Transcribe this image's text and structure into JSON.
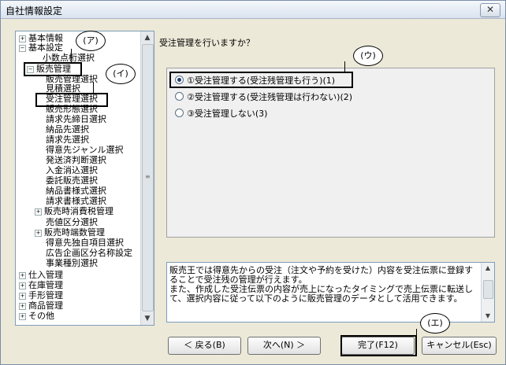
{
  "window": {
    "title": "自社情報設定",
    "close_glyph": "✕"
  },
  "tree": {
    "items": [
      {
        "label": "基本情報",
        "exp": "+"
      },
      {
        "label": "基本設定",
        "exp": "−"
      },
      {
        "label": "小数点桁選択",
        "exp": ""
      },
      {
        "label": "販売管理",
        "exp": "−"
      },
      {
        "label": "販売管理選択",
        "exp": ""
      },
      {
        "label": "見積選択",
        "exp": ""
      },
      {
        "label": "受注管理選択",
        "exp": ""
      },
      {
        "label": "販売形態選択",
        "exp": ""
      },
      {
        "label": "請求先締日選択",
        "exp": ""
      },
      {
        "label": "納品先選択",
        "exp": ""
      },
      {
        "label": "請求先選択",
        "exp": ""
      },
      {
        "label": "得意先ジャンル選択",
        "exp": ""
      },
      {
        "label": "発送済判断選択",
        "exp": ""
      },
      {
        "label": "入金消込選択",
        "exp": ""
      },
      {
        "label": "委託販売選択",
        "exp": ""
      },
      {
        "label": "納品書様式選択",
        "exp": ""
      },
      {
        "label": "請求書様式選択",
        "exp": ""
      },
      {
        "label": "販売時消費税管理",
        "exp": "+"
      },
      {
        "label": "売値区分選択",
        "exp": ""
      },
      {
        "label": "販売時端数管理",
        "exp": "+"
      },
      {
        "label": "得意先独自項目選択",
        "exp": ""
      },
      {
        "label": "広告企画区分名称設定",
        "exp": ""
      },
      {
        "label": "事業種別選択",
        "exp": ""
      },
      {
        "label": "仕入管理",
        "exp": "+"
      },
      {
        "label": "在庫管理",
        "exp": "+"
      },
      {
        "label": "手形管理",
        "exp": "+"
      },
      {
        "label": "商品管理",
        "exp": "+"
      },
      {
        "label": "その他",
        "exp": "+"
      }
    ]
  },
  "main": {
    "question": "受注管理を行いますか？",
    "options": [
      {
        "label": "①受注管理する(受注残管理も行う)(1)",
        "selected": true
      },
      {
        "label": "②受注管理する(受注残管理は行わない)(2)",
        "selected": false
      },
      {
        "label": "③受注管理しない(3)",
        "selected": false
      }
    ],
    "description": "販売王では得意先からの受注（注文や予約を受けた）内容を受注伝票に登録することで受注残の管理が行えます。\nまた、作成した受注伝票の内容が売上になったタイミングで売上伝票に転送して、選択内容に従って以下のように販売管理のデータとして活用できます。"
  },
  "buttons": {
    "back": "＜ 戻る(B)",
    "next": "次へ(N) ＞",
    "finish": "完了(F12)",
    "cancel": "キャンセル(Esc)"
  },
  "callouts": {
    "a": "(ア)",
    "i": "(イ)",
    "u": "(ウ)",
    "e": "(エ)"
  },
  "icons": {
    "scroll_up": "▲",
    "scroll_down": "▼",
    "grip": "≡"
  }
}
